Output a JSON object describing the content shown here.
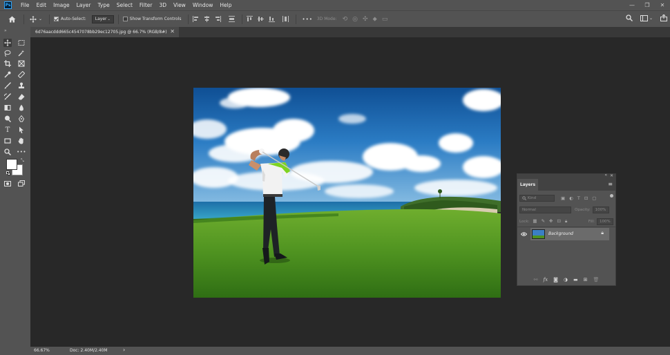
{
  "app": {
    "logo": "Ps"
  },
  "menu": [
    "File",
    "Edit",
    "Image",
    "Layer",
    "Type",
    "Select",
    "Filter",
    "3D",
    "View",
    "Window",
    "Help"
  ],
  "window_controls": {
    "minimize": "—",
    "restore": "❐",
    "close": "✕"
  },
  "options_bar": {
    "auto_select_label": "Auto-Select:",
    "auto_select_checked": true,
    "auto_select_target": "Layer",
    "show_transform_label": "Show Transform Controls",
    "show_transform_checked": false,
    "more_label": "•••",
    "mode_3d_label": "3D Mode:"
  },
  "document_tab": {
    "title": "6d76aacddd665c4547078bb29ec12705.jpg @ 66.7% (RGB/8#)",
    "close": "✕"
  },
  "status_bar": {
    "zoom": "66.67%",
    "doc_info": "Doc: 2.40M/2.40M",
    "arrow": "›"
  },
  "layers_panel": {
    "tab_label": "Layers",
    "kind_placeholder": "Kind",
    "blend_mode": "Normal",
    "opacity_label": "Opacity:",
    "opacity_value": "100%",
    "lock_label": "Lock:",
    "fill_label": "Fill:",
    "fill_value": "100%",
    "layers": [
      {
        "name": "Background",
        "visible": true,
        "locked": true
      }
    ]
  },
  "colors": {
    "accent": "#31a8ff",
    "panel": "#535353",
    "canvas": "#282828"
  }
}
